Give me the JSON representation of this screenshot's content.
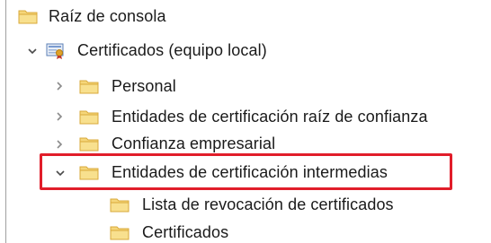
{
  "tree": {
    "root": {
      "label": "Raíz de consola",
      "icon": "folder-icon"
    },
    "computer": {
      "label": "Certificados (equipo local)",
      "icon": "certificate-store-icon",
      "expanded": true
    },
    "children": [
      {
        "label": "Personal",
        "expanded": false
      },
      {
        "label": "Entidades de certificación raíz de confianza",
        "expanded": false
      },
      {
        "label": "Confianza empresarial",
        "expanded": false
      },
      {
        "label": "Entidades de certificación intermedias",
        "expanded": true,
        "highlighted": true
      }
    ],
    "grandchildren": [
      {
        "label": "Lista de revocación de certificados"
      },
      {
        "label": "Certificados"
      }
    ]
  },
  "colors": {
    "highlight_border": "#e11d2a",
    "folder_fill": "#f5d67a",
    "folder_stroke": "#d9a93a",
    "chevron": "#6e6e6e"
  }
}
